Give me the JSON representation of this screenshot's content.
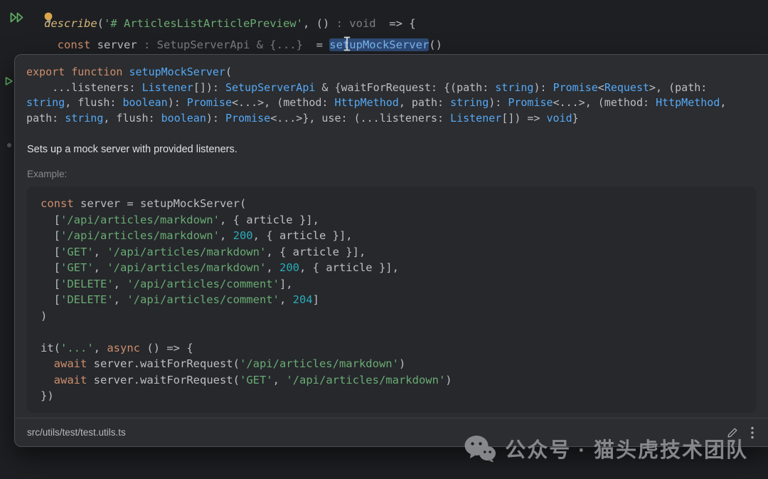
{
  "editor": {
    "lines": [
      [
        {
          "t": "describe",
          "c": "testfn"
        },
        {
          "t": "(",
          "c": "def"
        },
        {
          "t": "'# ArticlesListArticlePreview'",
          "c": "str"
        },
        {
          "t": ", ",
          "c": "def"
        },
        {
          "t": "()",
          "c": "def"
        },
        {
          "t": " : void ",
          "c": "hint"
        },
        {
          "t": " => {",
          "c": "def"
        }
      ],
      [
        {
          "t": "  ",
          "c": "def"
        },
        {
          "t": "const",
          "c": "kw"
        },
        {
          "t": " server ",
          "c": "def"
        },
        {
          "t": ": SetupServerApi & {...}",
          "c": "hint"
        },
        {
          "t": "  = ",
          "c": "def"
        },
        {
          "t": "setupMockServer",
          "c": "hl"
        },
        {
          "t": "()",
          "c": "def"
        }
      ]
    ]
  },
  "popup": {
    "signature": [
      [
        {
          "t": "export function ",
          "c": "kw"
        },
        {
          "t": "setupMockServer",
          "c": "fn"
        },
        {
          "t": "(",
          "c": "def"
        }
      ],
      [
        {
          "t": "    ...listeners: ",
          "c": "def"
        },
        {
          "t": "Listener",
          "c": "type"
        },
        {
          "t": "[]): ",
          "c": "def"
        },
        {
          "t": "SetupServerApi",
          "c": "type"
        },
        {
          "t": " & {waitForRequest: {(path: ",
          "c": "def"
        },
        {
          "t": "string",
          "c": "type"
        },
        {
          "t": "): ",
          "c": "def"
        },
        {
          "t": "Promise",
          "c": "type"
        },
        {
          "t": "<",
          "c": "def"
        },
        {
          "t": "Request",
          "c": "type"
        },
        {
          "t": ">, (path:",
          "c": "def"
        }
      ],
      [
        {
          "t": "string",
          "c": "type"
        },
        {
          "t": ", flush: ",
          "c": "def"
        },
        {
          "t": "boolean",
          "c": "type"
        },
        {
          "t": "): ",
          "c": "def"
        },
        {
          "t": "Promise",
          "c": "type"
        },
        {
          "t": "<...>, (method: ",
          "c": "def"
        },
        {
          "t": "HttpMethod",
          "c": "type"
        },
        {
          "t": ", path: ",
          "c": "def"
        },
        {
          "t": "string",
          "c": "type"
        },
        {
          "t": "): ",
          "c": "def"
        },
        {
          "t": "Promise",
          "c": "type"
        },
        {
          "t": "<...>, (method: ",
          "c": "def"
        },
        {
          "t": "HttpMethod",
          "c": "type"
        },
        {
          "t": ",",
          "c": "def"
        }
      ],
      [
        {
          "t": "path: ",
          "c": "def"
        },
        {
          "t": "string",
          "c": "type"
        },
        {
          "t": ", flush: ",
          "c": "def"
        },
        {
          "t": "boolean",
          "c": "type"
        },
        {
          "t": "): ",
          "c": "def"
        },
        {
          "t": "Promise",
          "c": "type"
        },
        {
          "t": "<...>}, use: (...listeners: ",
          "c": "def"
        },
        {
          "t": "Listener",
          "c": "type"
        },
        {
          "t": "[]) => ",
          "c": "def"
        },
        {
          "t": "void",
          "c": "type"
        },
        {
          "t": "}",
          "c": "def"
        }
      ]
    ],
    "description": "Sets up a mock server with provided listeners.",
    "example_label": "Example:",
    "example_code": [
      [
        {
          "t": "const",
          "c": "kw"
        },
        {
          "t": " server = setupMockServer(",
          "c": "def"
        }
      ],
      [
        {
          "t": "  [",
          "c": "def"
        },
        {
          "t": "'/api/articles/markdown'",
          "c": "str"
        },
        {
          "t": ", { article }],",
          "c": "def"
        }
      ],
      [
        {
          "t": "  [",
          "c": "def"
        },
        {
          "t": "'/api/articles/markdown'",
          "c": "str"
        },
        {
          "t": ", ",
          "c": "def"
        },
        {
          "t": "200",
          "c": "num"
        },
        {
          "t": ", { article }],",
          "c": "def"
        }
      ],
      [
        {
          "t": "  [",
          "c": "def"
        },
        {
          "t": "'GET'",
          "c": "str"
        },
        {
          "t": ", ",
          "c": "def"
        },
        {
          "t": "'/api/articles/markdown'",
          "c": "str"
        },
        {
          "t": ", { article }],",
          "c": "def"
        }
      ],
      [
        {
          "t": "  [",
          "c": "def"
        },
        {
          "t": "'GET'",
          "c": "str"
        },
        {
          "t": ", ",
          "c": "def"
        },
        {
          "t": "'/api/articles/markdown'",
          "c": "str"
        },
        {
          "t": ", ",
          "c": "def"
        },
        {
          "t": "200",
          "c": "num"
        },
        {
          "t": ", { article }],",
          "c": "def"
        }
      ],
      [
        {
          "t": "  [",
          "c": "def"
        },
        {
          "t": "'DELETE'",
          "c": "str"
        },
        {
          "t": ", ",
          "c": "def"
        },
        {
          "t": "'/api/articles/comment'",
          "c": "str"
        },
        {
          "t": "],",
          "c": "def"
        }
      ],
      [
        {
          "t": "  [",
          "c": "def"
        },
        {
          "t": "'DELETE'",
          "c": "str"
        },
        {
          "t": ", ",
          "c": "def"
        },
        {
          "t": "'/api/articles/comment'",
          "c": "str"
        },
        {
          "t": ", ",
          "c": "def"
        },
        {
          "t": "204",
          "c": "num"
        },
        {
          "t": "]",
          "c": "def"
        }
      ],
      [
        {
          "t": ")",
          "c": "def"
        }
      ],
      [
        {
          "t": " ",
          "c": "def"
        }
      ],
      [
        {
          "t": "it(",
          "c": "def"
        },
        {
          "t": "'...'",
          "c": "str"
        },
        {
          "t": ", ",
          "c": "def"
        },
        {
          "t": "async",
          "c": "kw"
        },
        {
          "t": " () => {",
          "c": "def"
        }
      ],
      [
        {
          "t": "  ",
          "c": "def"
        },
        {
          "t": "await",
          "c": "kw"
        },
        {
          "t": " server.waitForRequest(",
          "c": "def"
        },
        {
          "t": "'/api/articles/markdown'",
          "c": "str"
        },
        {
          "t": ")",
          "c": "def"
        }
      ],
      [
        {
          "t": "  ",
          "c": "def"
        },
        {
          "t": "await",
          "c": "kw"
        },
        {
          "t": " server.waitForRequest(",
          "c": "def"
        },
        {
          "t": "'GET'",
          "c": "str"
        },
        {
          "t": ", ",
          "c": "def"
        },
        {
          "t": "'/api/articles/markdown'",
          "c": "str"
        },
        {
          "t": ")",
          "c": "def"
        }
      ],
      [
        {
          "t": "})",
          "c": "def"
        }
      ]
    ],
    "footer": {
      "path": "src/utils/test/test.utils.ts"
    }
  },
  "icons": {
    "run": "run-all-tests",
    "gutter_run": "run-single-test",
    "bulb": "intention-lightbulb",
    "edit": "edit-pencil",
    "more": "more-options-kebab",
    "wechat": "wechat-logo",
    "cursor": "text-ibeam-cursor"
  },
  "watermark": {
    "text": "公众号 · 猫头虎技术团队"
  },
  "colors": {
    "editor_bg": "#1e1f22",
    "popup_bg": "#2b2d30",
    "snippet_bg": "#26282c",
    "keyword": "#cf8e6d",
    "string": "#6aab73",
    "number": "#2aacb8",
    "type_link": "#56a8f5",
    "hint_gray": "#7b7e85",
    "highlight_bg": "#2e4b78",
    "run_green": "#5fad65",
    "watermark_gray": "#8f9093"
  }
}
